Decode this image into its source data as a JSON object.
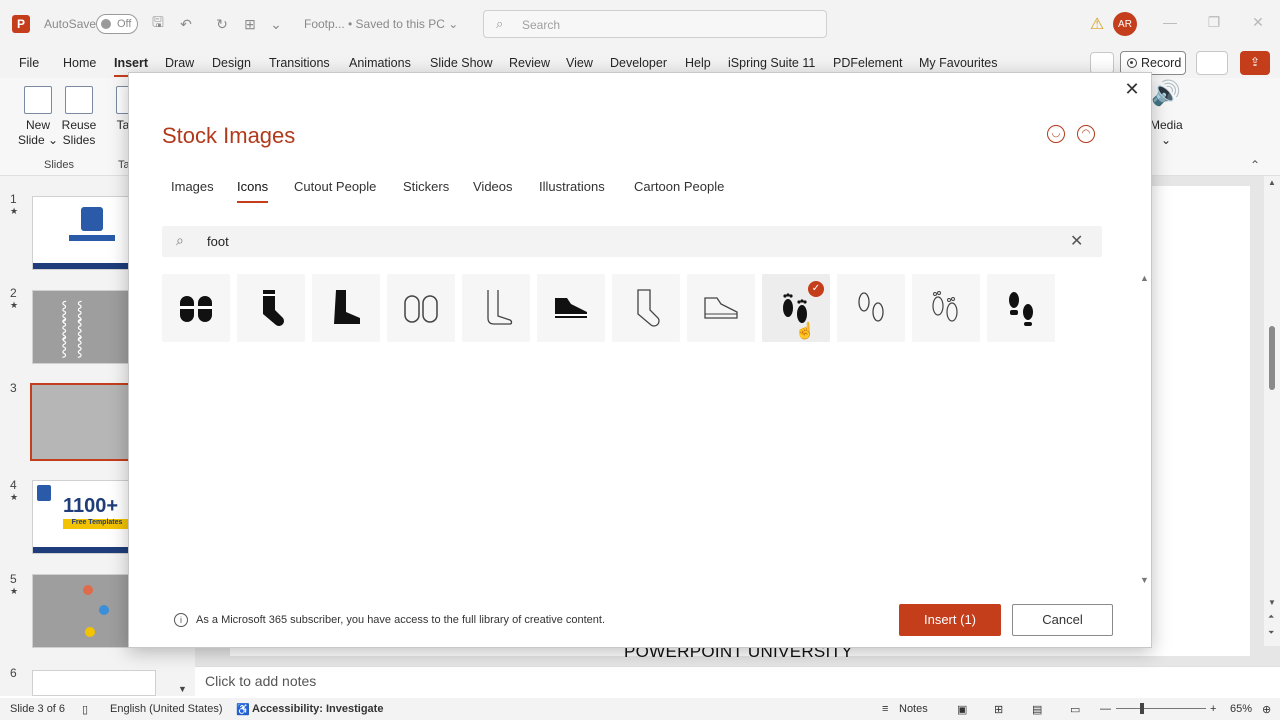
{
  "titlebar": {
    "autosave_label": "AutoSave",
    "autosave_state": "Off",
    "doc_title": "Footp... • Saved to this PC ⌄",
    "search_placeholder": "Search",
    "avatar_initials": "AR"
  },
  "menu": [
    "File",
    "Home",
    "Insert",
    "Draw",
    "Design",
    "Transitions",
    "Animations",
    "Slide Show",
    "Review",
    "View",
    "Developer",
    "Help",
    "iSpring Suite 11",
    "PDFelement",
    "My Favourites"
  ],
  "menu_active": "Insert",
  "record_label": "Record",
  "ribbon": {
    "new_slide": "New Slide ⌄",
    "reuse_slides": "Reuse Slides",
    "tab_partial": "Ta",
    "group_slides": "Slides",
    "group_partial": "Ta",
    "media": "Media ⌄"
  },
  "slides": [
    {
      "num": "1",
      "star": "★"
    },
    {
      "num": "2",
      "star": "★"
    },
    {
      "num": "3",
      "star": ""
    },
    {
      "num": "4",
      "star": "★",
      "text": "1100+",
      "sub": "Free Templates"
    },
    {
      "num": "5",
      "star": "★"
    },
    {
      "num": "6",
      "star": ""
    }
  ],
  "slide_text": "POWERPOINT UNIVERSITY",
  "notes_placeholder": "Click to add notes",
  "status": {
    "slide": "Slide 3 of 6",
    "language": "English (United States)",
    "accessibility": "Accessibility: Investigate",
    "notes": "Notes",
    "zoom": "65%"
  },
  "dialog": {
    "title": "Stock Images",
    "tabs": [
      "Images",
      "Icons",
      "Cutout People",
      "Stickers",
      "Videos",
      "Illustrations",
      "Cartoon People"
    ],
    "active_tab": "Icons",
    "search_value": "foot",
    "icons": [
      {
        "name": "slippers-filled-icon",
        "selected": false
      },
      {
        "name": "sock-filled-icon",
        "selected": false
      },
      {
        "name": "boot-filled-icon",
        "selected": false
      },
      {
        "name": "slippers-outline-icon",
        "selected": false
      },
      {
        "name": "foot-outline-icon",
        "selected": false
      },
      {
        "name": "sneaker-filled-icon",
        "selected": false
      },
      {
        "name": "sock-outline-icon",
        "selected": false
      },
      {
        "name": "sneaker-outline-icon",
        "selected": false
      },
      {
        "name": "footprints-filled-icon",
        "selected": true
      },
      {
        "name": "shoe-prints-outline-icon",
        "selected": false
      },
      {
        "name": "footprints-outline-icon",
        "selected": false
      },
      {
        "name": "shoe-prints-filled-icon",
        "selected": false
      }
    ],
    "info": "As a Microsoft 365 subscriber, you have access to the full library of creative content.",
    "insert_label": "Insert (1)",
    "cancel_label": "Cancel"
  }
}
